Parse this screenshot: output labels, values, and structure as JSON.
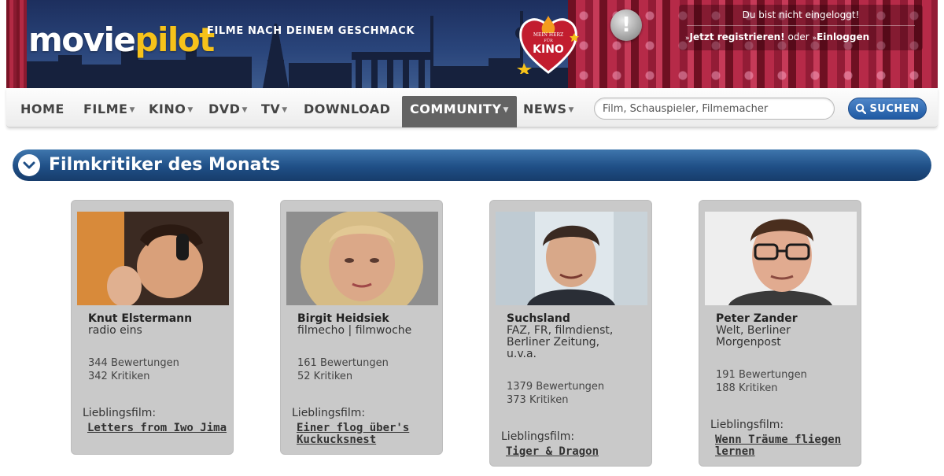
{
  "header": {
    "logo_part1": "movie",
    "logo_part2": "pilot",
    "tagline": "FILME NACH DEINEM GESCHMACK",
    "badge_line1": "MEIN HERZ",
    "badge_line2": "FÜR",
    "badge_main": "KINO",
    "login_status": "Du bist nicht eingeloggt!",
    "register_label": "Jetzt registrieren!",
    "or_label": "oder",
    "login_label": "Einloggen"
  },
  "nav": {
    "items": [
      {
        "label": "HOME",
        "caret": false
      },
      {
        "label": "FILME",
        "caret": true
      },
      {
        "label": "KINO",
        "caret": true
      },
      {
        "label": "DVD",
        "caret": true
      },
      {
        "label": "TV",
        "caret": true
      },
      {
        "label": "DOWNLOAD",
        "caret": false
      },
      {
        "label": "COMMUNITY",
        "caret": true,
        "active": true
      },
      {
        "label": "NEWS",
        "caret": true
      }
    ],
    "search_placeholder": "Film, Schauspieler, Filmemacher",
    "search_button": "SUCHEN"
  },
  "section": {
    "title": "Filmkritiker des Monats"
  },
  "critics": [
    {
      "name": "Knut Elstermann",
      "media": "radio eins",
      "ratings": "344 Bewertungen",
      "reviews": "342 Kritiken",
      "fav_label": "Lieblingsfilm:",
      "fav_film": "Letters from Iwo Jima"
    },
    {
      "name": "Birgit Heidsiek",
      "media": "filmecho | filmwoche",
      "ratings": "161 Bewertungen",
      "reviews": "52 Kritiken",
      "fav_label": "Lieblingsfilm:",
      "fav_film": "Einer flog über's Kuckucksnest"
    },
    {
      "name": "Suchsland",
      "media": "FAZ, FR, filmdienst, Berliner Zeitung, u.v.a.",
      "ratings": "1379 Bewertungen",
      "reviews": "373 Kritiken",
      "fav_label": "Lieblingsfilm:",
      "fav_film": "Tiger & Dragon"
    },
    {
      "name": "Peter Zander",
      "media": "Welt, Berliner Morgenpost",
      "ratings": "191 Bewertungen",
      "reviews": "188 Kritiken",
      "fav_label": "Lieblingsfilm:",
      "fav_film": "Wenn Träume fliegen lernen"
    }
  ],
  "colors": {
    "nav_active_bg": "#636363",
    "section_blue": "#1f4f86",
    "card_bg": "#c9c9c9",
    "logo_accent": "#f6c21a"
  }
}
